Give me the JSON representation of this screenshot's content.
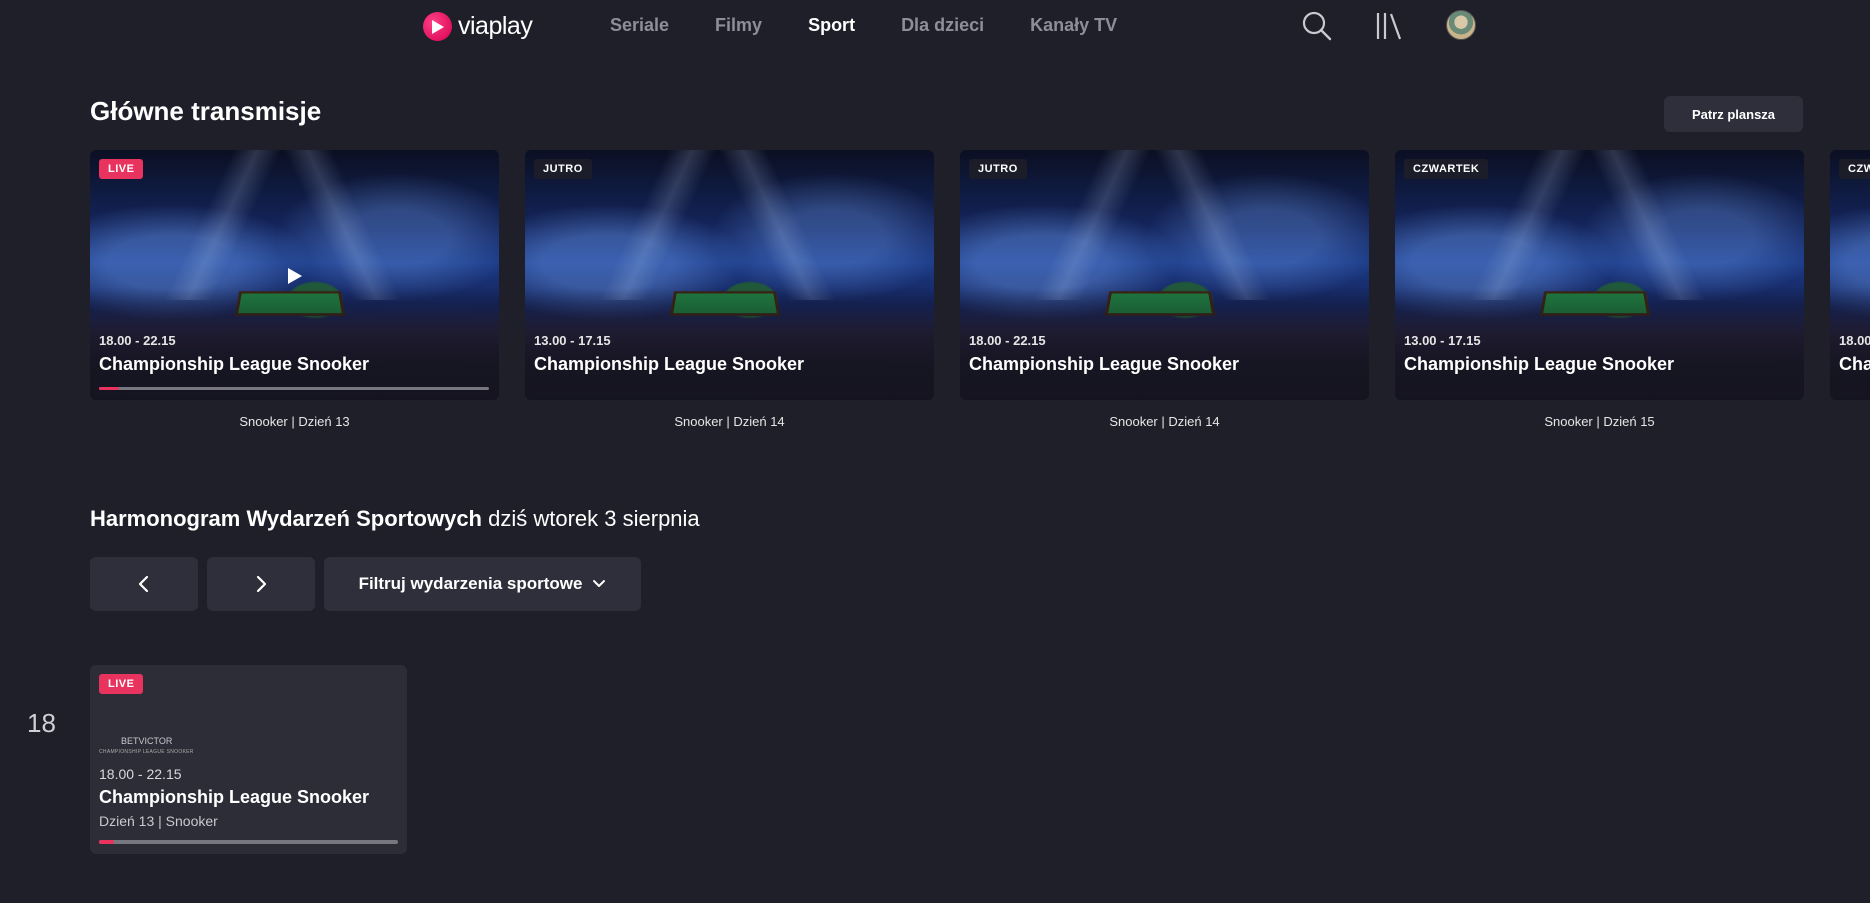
{
  "nav": {
    "brand": "viaplay",
    "links": [
      "Seriale",
      "Filmy",
      "Sport",
      "Dla dzieci",
      "Kanały TV"
    ],
    "active": "Sport",
    "icons": [
      "search-icon",
      "library-icon",
      "avatar"
    ]
  },
  "featured": {
    "title": "Główne transmisje",
    "see_all": "Patrz plansza",
    "cards": [
      {
        "badge": "LIVE",
        "time": "18.00 - 22.15",
        "title": "Championship League Snooker",
        "meta": "Snooker | Dzień 13",
        "live": true,
        "progress": 0.05
      },
      {
        "badge": "JUTRO",
        "time": "13.00 - 17.15",
        "title": "Championship League Snooker",
        "meta": "Snooker | Dzień 14",
        "live": false
      },
      {
        "badge": "JUTRO",
        "time": "18.00 - 22.15",
        "title": "Championship League Snooker",
        "meta": "Snooker | Dzień 14",
        "live": false
      },
      {
        "badge": "CZWARTEK",
        "time": "13.00 - 17.15",
        "title": "Championship League Snooker",
        "meta": "Snooker | Dzień 15",
        "live": false
      },
      {
        "badge": "CZW",
        "time": "18.00",
        "title": "Cha",
        "meta": "",
        "live": false
      }
    ]
  },
  "schedule": {
    "heading_bold": "Harmonogram Wydarzeń Sportowych",
    "heading_date": "dziś wtorek 3 sierpnia",
    "filter_label": "Filtruj wydarzenia sportowe",
    "hour": "18",
    "event": {
      "badge": "LIVE",
      "logo_brand": "BETVICTOR",
      "logo_sub": "CHAMPIONSHIP LEAGUE SNOOKER",
      "time": "18.00 - 22.15",
      "title": "Championship League Snooker",
      "meta": "Dzień 13 | Snooker",
      "progress": 0.05
    }
  },
  "colors": {
    "background": "#1f1f2a",
    "accent_live": "#e8335f",
    "button_bg": "#2e2f3a"
  }
}
